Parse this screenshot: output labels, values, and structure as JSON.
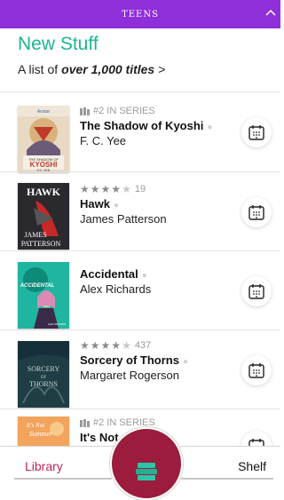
{
  "header": {
    "section": "TEENS",
    "collapse_icon": "chevron-up-icon"
  },
  "list": {
    "title": "New Stuff",
    "subtitle_prefix": "A list of",
    "subtitle_count": "over 1,000 titles",
    "subtitle_chevron": ">"
  },
  "books": [
    {
      "series": "#2 IN SERIES",
      "title": "The Shadow of Kyoshi",
      "author": "F. C. Yee",
      "cover_text": [
        "Avatar",
        "THE SHADOW OF",
        "KYOSHI",
        "F.C. YEE"
      ],
      "colors": {
        "cover_bg": "#e8d9c4",
        "cover_accent": "#c0392b"
      },
      "action_icon": "calendar-icon"
    },
    {
      "rating": 4.5,
      "rating_count": "19",
      "title": "Hawk",
      "author": "James Patterson",
      "cover_text": [
        "HAWK",
        "JAMES",
        "PATTERSON"
      ],
      "colors": {
        "cover_bg": "#2a2a2e",
        "cover_accent": "#c62828"
      },
      "action_icon": "calendar-icon"
    },
    {
      "title": "Accidental",
      "author": "Alex Richards",
      "cover_text": [
        "ACCIDENTAL",
        "ALEX RICHARDS"
      ],
      "colors": {
        "cover_bg": "#1fb5a0",
        "cover_accent": "#d98ab5"
      },
      "action_icon": "calendar-icon"
    },
    {
      "rating": 4.5,
      "rating_count": "437",
      "title": "Sorcery of Thorns",
      "author": "Margaret Rogerson",
      "cover_text": [
        "SORCERY",
        "OF",
        "THORNS"
      ],
      "colors": {
        "cover_bg": "#1f3d44",
        "cover_accent": "#c9d8d6"
      },
      "action_icon": "calendar-icon"
    },
    {
      "series": "#2 IN SERIES",
      "title": "It's Not",
      "cover_text": [
        "It's Not",
        "Summer"
      ],
      "colors": {
        "cover_bg": "#f2a45c",
        "cover_accent": "#ffffff"
      },
      "action_icon": "calendar-icon"
    }
  ],
  "bottom_nav": {
    "library": "Library",
    "shelf": "Shelf",
    "center_icon": "book-stack-icon"
  },
  "colors": {
    "header_bg": "#8e2fd9",
    "title": "#1bb592",
    "library_tab": "#c0245c",
    "fab_bg": "#9b1c3c"
  }
}
